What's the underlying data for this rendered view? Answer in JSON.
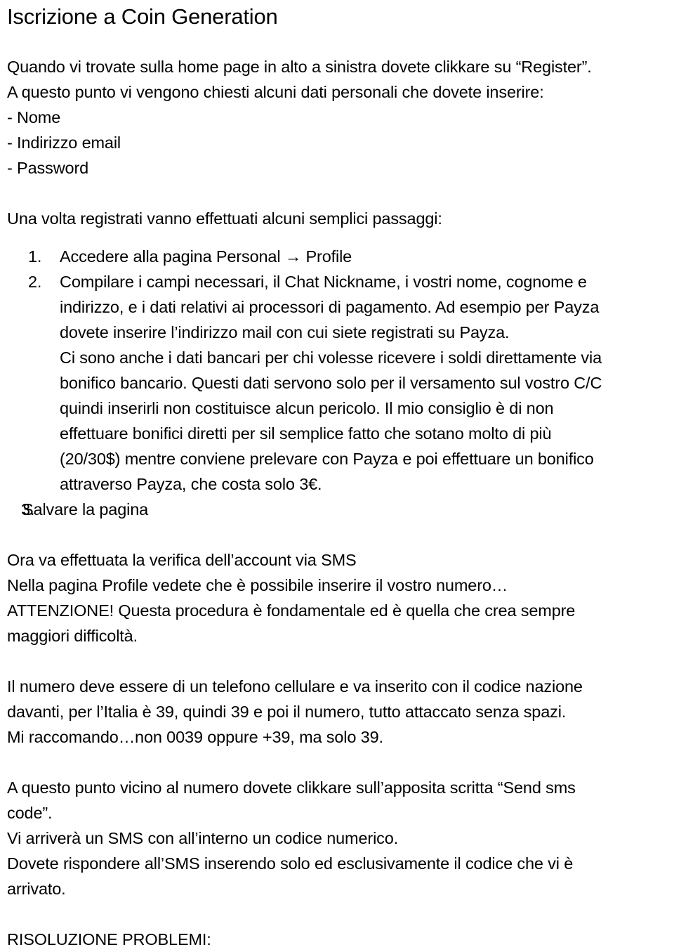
{
  "document": {
    "title": "Iscrizione a Coin Generation",
    "intro": {
      "line1": "Quando vi trovate sulla home page in alto a sinistra dovete clikkare su “Register”.",
      "line2": "A questo punto vi vengono chiesti alcuni dati personali che dovete inserire:",
      "bullets": [
        "- Nome",
        "- Indirizzo email",
        "- Password"
      ],
      "line3": "Una volta registrati vanno effettuati alcuni semplici passaggi:"
    },
    "steps": [
      {
        "marker": "1.",
        "lines": [
          "Accedere alla pagina Personal → Profile"
        ]
      },
      {
        "marker": "2.",
        "lines": [
          "Compilare i campi necessari, il Chat Nickname, i vostri nome, cognome e",
          "indirizzo, e i dati relativi ai processori di pagamento. Ad esempio per Payza",
          "dovete inserire l’indirizzo mail con cui siete registrati su Payza.",
          "Ci sono anche i dati bancari per chi volesse ricevere i soldi direttamente via",
          "bonifico bancario. Questi dati servono solo per il versamento sul vostro C/C",
          "quindi inserirli non costituisce alcun pericolo. Il mio consiglio è di non",
          "effettuare bonifici diretti per sil semplice fatto che sotano molto di più",
          "(20/30$) mentre conviene prelevare con Payza e poi effettuare un bonifico",
          "attraverso Payza, che costa solo 3€."
        ]
      },
      {
        "marker": "3.",
        "lines": [
          "Salvare la pagina"
        ]
      }
    ],
    "sms_section": {
      "line1": "Ora va effettuata la verifica dell’account via SMS",
      "line2": "Nella pagina Profile vedete che è possibile inserire il vostro numero…",
      "line3": "ATTENZIONE! Questa procedura è fondamentale ed è quella che crea sempre",
      "line4": "maggiori difficoltà."
    },
    "number_section": {
      "line1": "Il numero deve essere di un telefono cellulare e va inserito con il codice nazione",
      "line2": "davanti, per l’Italia è 39, quindi 39 e poi il numero, tutto attaccato senza spazi.",
      "line3": "Mi raccomando…non 0039 oppure +39, ma solo 39."
    },
    "send_section": {
      "line1": "A questo punto vicino al numero dovete clikkare sull’apposita scritta “Send sms",
      "line2": "code”.",
      "line3": "Vi arriverà un SMS con all’interno un codice numerico.",
      "line4": "Dovete rispondere all’SMS inserendo solo ed esclusivamente il codice che vi è",
      "line5": "arrivato."
    },
    "footer": {
      "heading": "RISOLUZIONE PROBLEMI:"
    }
  }
}
